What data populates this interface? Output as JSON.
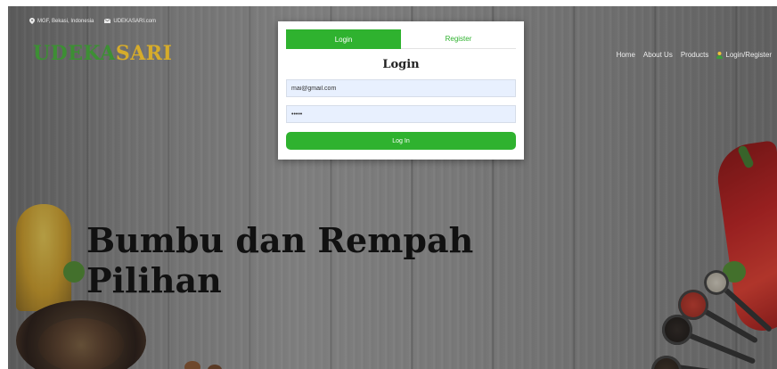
{
  "topbar": {
    "location": "MGF, Bekasi, Indonesia",
    "email": "UDEKASARI.com"
  },
  "brand": {
    "part1": "UDEKA",
    "part2": "SARI",
    "part1_color": "#3d8f34",
    "part2_color": "#d6ac2a"
  },
  "nav": {
    "items": [
      "Home",
      "About Us",
      "Products"
    ],
    "login_label": "Login/Register",
    "login_icon": "user-icon"
  },
  "hero": {
    "line1": "Bumbu dan Rempah",
    "line2": "Pilihan"
  },
  "login_modal": {
    "tabs": [
      {
        "label": "Login",
        "active": true
      },
      {
        "label": "Register",
        "active": false
      }
    ],
    "title": "Login",
    "email_value": "mai@gmail.com",
    "password_value": "•••••",
    "submit_label": "Log In",
    "accent_color": "#2fb22f"
  }
}
